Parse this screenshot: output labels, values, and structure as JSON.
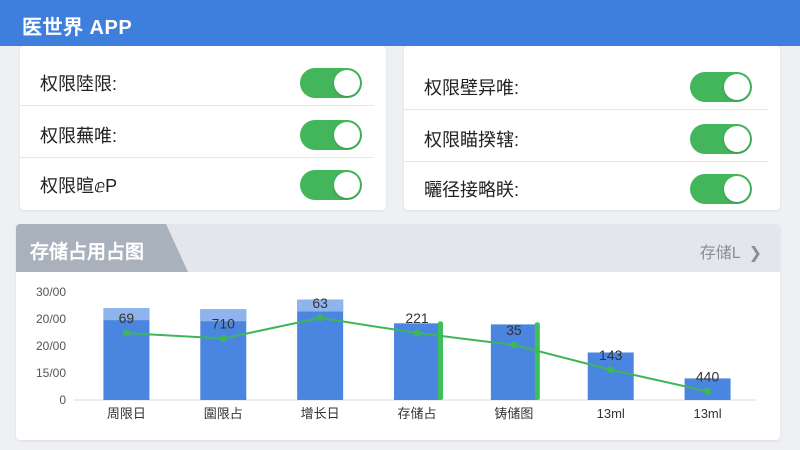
{
  "app": {
    "title": "医世界 APP"
  },
  "permissions_left": [
    {
      "label": "权限陸限:",
      "enabled": true
    },
    {
      "label": "权限蕪唯:",
      "enabled": true
    },
    {
      "label": "权限暄ⅇP",
      "enabled": true
    }
  ],
  "permissions_right": [
    {
      "label": "权限壁异唯:",
      "enabled": true
    },
    {
      "label": "权限瞄揆辖:",
      "enabled": true
    },
    {
      "label": "曬径接略眹:",
      "enabled": true
    }
  ],
  "storage_section": {
    "title": "存储占用占图",
    "more_label": "存储L",
    "more_icon": "chevron-right-icon"
  },
  "chart_data": {
    "type": "bar",
    "categories": [
      "周限日",
      "圍限占",
      "增长日",
      "存储占",
      "铸储图",
      "13ml",
      "13ml"
    ],
    "y_tick_labels": [
      "30/00",
      "20/00",
      "20/00",
      "15/00",
      "0"
    ],
    "series": [
      {
        "values": [
          85,
          84,
          93,
          71,
          70,
          44,
          20
        ]
      }
    ],
    "line_values": [
      62,
      57,
      76,
      62,
      51,
      28,
      8
    ],
    "data_labels": [
      "69",
      "710",
      "63",
      "221",
      "35",
      "143",
      "440"
    ],
    "colors": {
      "bar": "#4a86e0",
      "bar_top": "#8fb3ec",
      "line": "#3fb55a",
      "accent_bar": "#3fbf5b"
    }
  }
}
